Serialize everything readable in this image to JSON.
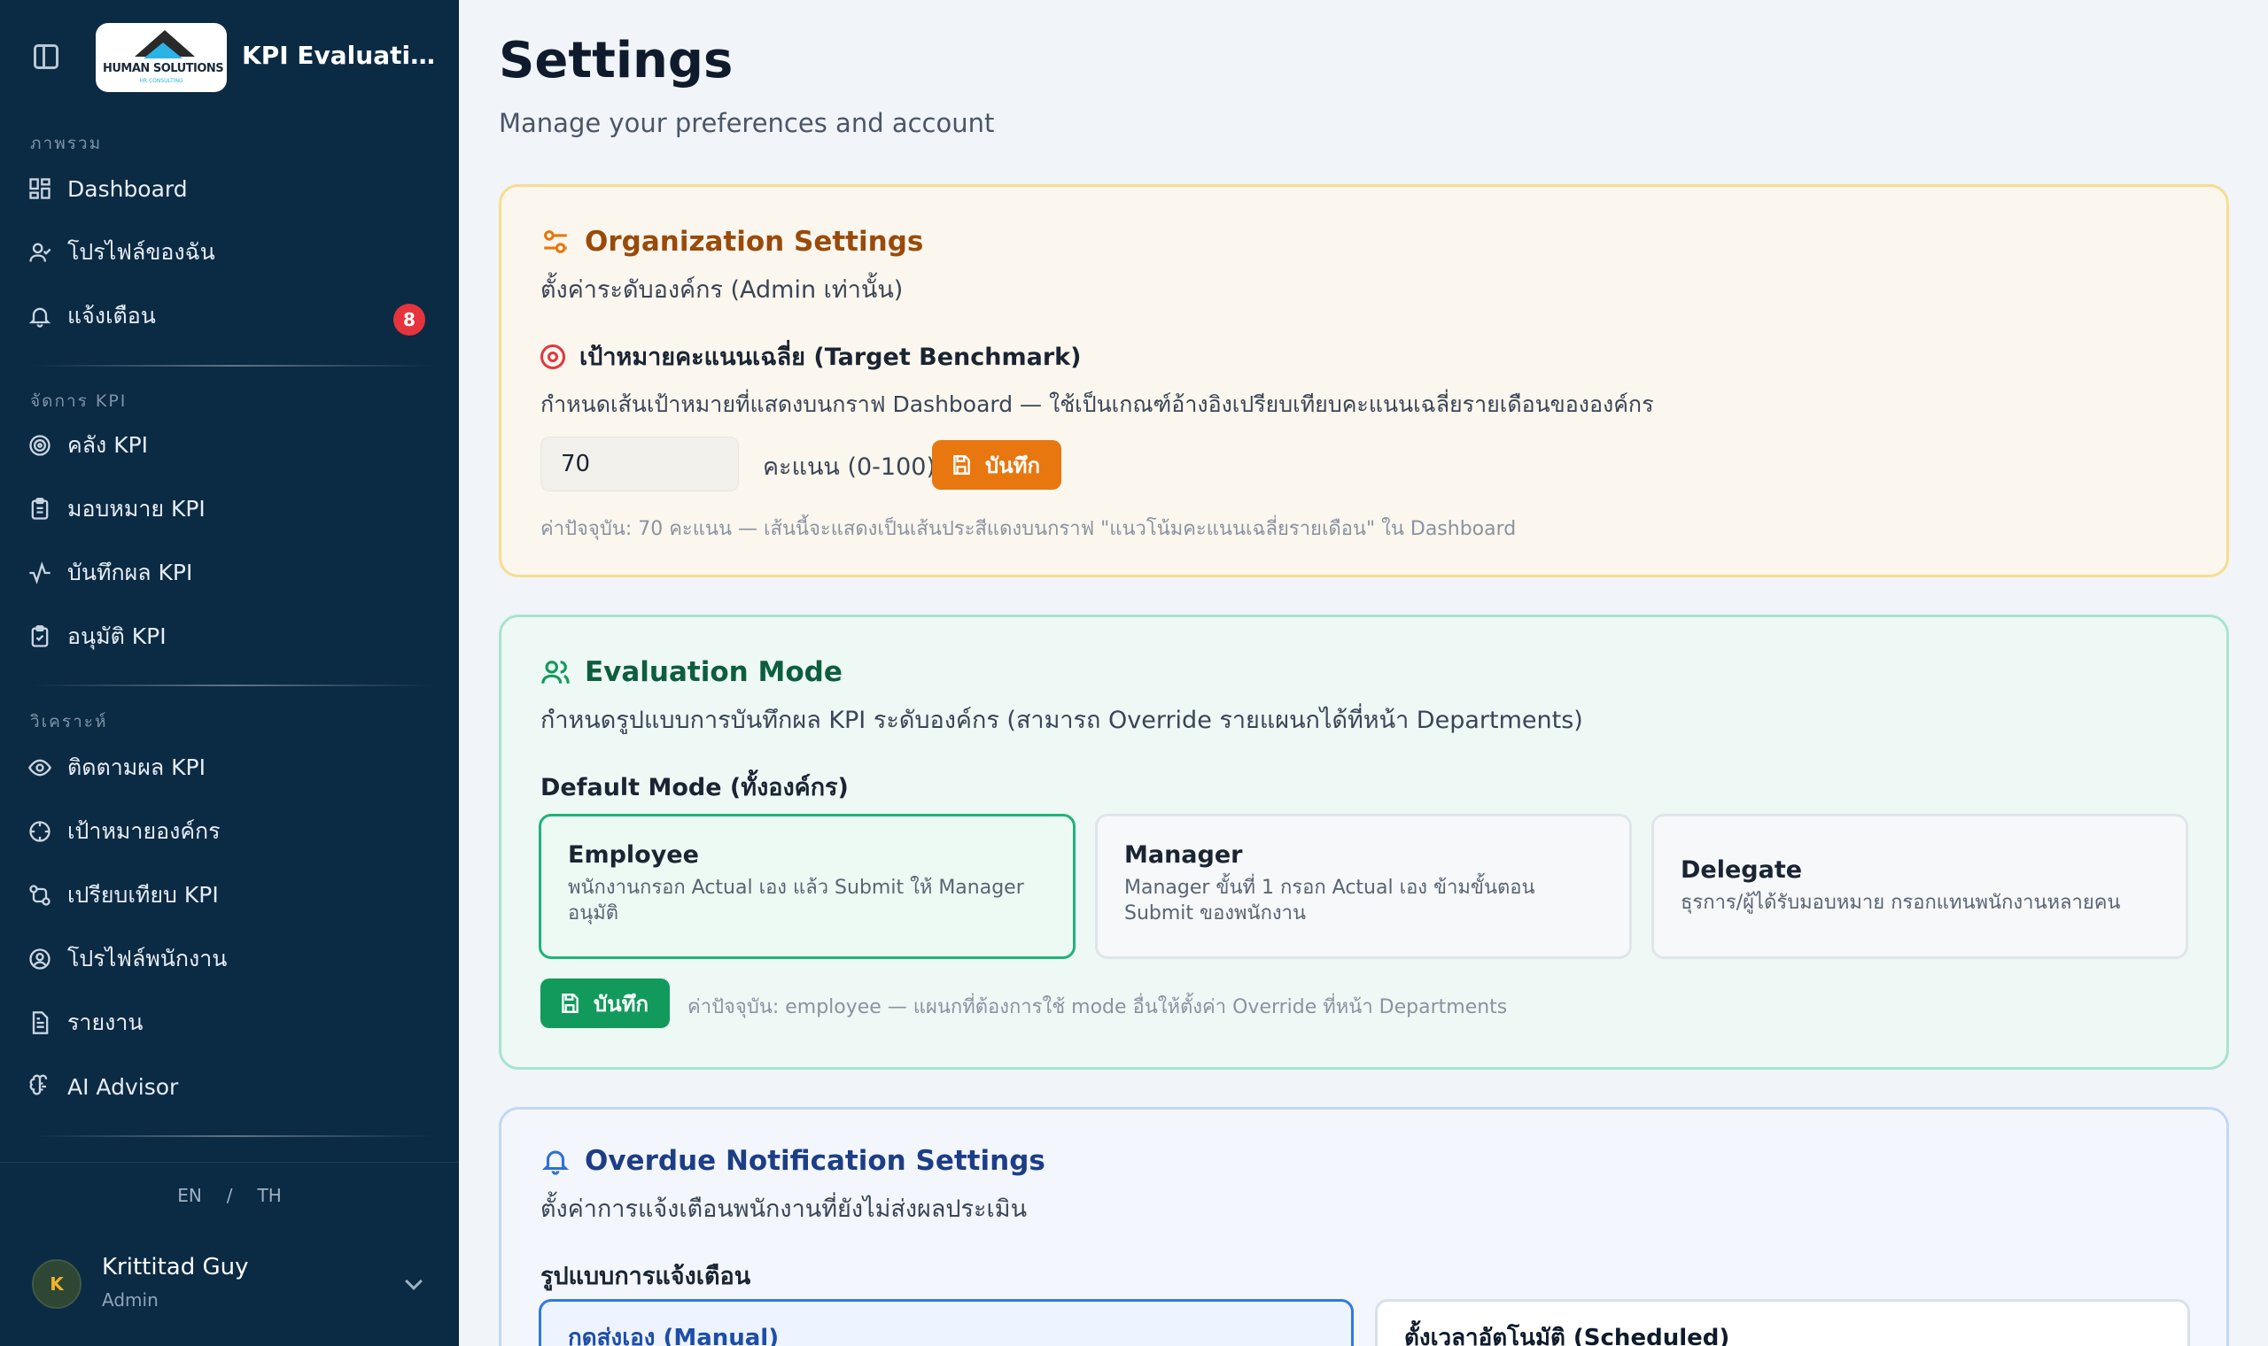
{
  "app": {
    "title": "KPI Evaluation ...",
    "logo_text": "HUMAN SOLUTIONS",
    "logo_sub": "HR CONSULTING"
  },
  "sidebar": {
    "sections": [
      {
        "label": "ภาพรวม"
      },
      {
        "label": "จัดการ KPI"
      },
      {
        "label": "วิเคราะห์"
      }
    ],
    "items": [
      {
        "label": "Dashboard",
        "icon": "dashboard-icon"
      },
      {
        "label": "โปรไฟล์ของฉัน",
        "icon": "user-icon"
      },
      {
        "label": "แจ้งเตือน",
        "icon": "bell-icon",
        "badge": "8"
      },
      {
        "label": "คลัง KPI",
        "icon": "target-icon"
      },
      {
        "label": "มอบหมาย KPI",
        "icon": "clipboard-list-icon"
      },
      {
        "label": "บันทึกผล KPI",
        "icon": "activity-icon"
      },
      {
        "label": "อนุมัติ KPI",
        "icon": "clipboard-check-icon"
      },
      {
        "label": "ติดตามผล KPI",
        "icon": "eye-icon"
      },
      {
        "label": "เป้าหมายองค์กร",
        "icon": "crosshair-icon"
      },
      {
        "label": "เปรียบเทียบ KPI",
        "icon": "compare-icon"
      },
      {
        "label": "โปรไฟล์พนักงาน",
        "icon": "user-circle-icon"
      },
      {
        "label": "รายงาน",
        "icon": "file-text-icon"
      },
      {
        "label": "AI Advisor",
        "icon": "brain-icon"
      }
    ],
    "lang": {
      "en": "EN",
      "sep": "/",
      "th": "TH"
    },
    "user": {
      "initial": "K",
      "name": "Krittitad Guy",
      "role": "Admin"
    }
  },
  "page": {
    "title": "Settings",
    "subtitle": "Manage your preferences and account"
  },
  "org_settings": {
    "title": "Organization Settings",
    "desc": "ตั้งค่าระดับองค์กร (Admin เท่านั้น)",
    "benchmark_title": "เป้าหมายคะแนนเฉลี่ย (Target Benchmark)",
    "benchmark_desc": "กำหนดเส้นเป้าหมายที่แสดงบนกราฟ Dashboard — ใช้เป็นเกณฑ์อ้างอิงเปรียบเทียบคะแนนเฉลี่ยรายเดือนขององค์กร",
    "value": "70",
    "unit": "คะแนน (0-100)",
    "save_label": "บันทึก",
    "hint": "ค่าปัจจุบัน: 70 คะแนน — เส้นนี้จะแสดงเป็นเส้นประสีแดงบนกราฟ \"แนวโน้มคะแนนเฉลี่ยรายเดือน\" ใน Dashboard"
  },
  "eval_mode": {
    "title": "Evaluation Mode",
    "desc": "กำหนดรูปแบบการบันทึกผล KPI ระดับองค์กร (สามารถ Override รายแผนกได้ที่หน้า Departments)",
    "default_label": "Default Mode (ทั้งองค์กร)",
    "modes": [
      {
        "title": "Employee",
        "desc": "พนักงานกรอก Actual เอง แล้ว Submit ให้ Manager อนุมัติ"
      },
      {
        "title": "Manager",
        "desc": "Manager ขั้นที่ 1 กรอก Actual เอง ข้ามขั้นตอน Submit ของพนักงาน"
      },
      {
        "title": "Delegate",
        "desc": "ธุรการ/ผู้ได้รับมอบหมาย กรอกแทนพนักงานหลายคน"
      }
    ],
    "save_label": "บันทึก",
    "hint": "ค่าปัจจุบัน: employee — แผนกที่ต้องการใช้ mode อื่นให้ตั้งค่า Override ที่หน้า Departments"
  },
  "notif": {
    "title": "Overdue Notification Settings",
    "desc": "ตั้งค่าการแจ้งเตือนพนักงานที่ยังไม่ส่งผลประเมิน",
    "format_label": "รูปแบบการแจ้งเตือน",
    "options": [
      {
        "label": "กดส่งเอง (Manual)"
      },
      {
        "label": "ตั้งเวลาอัตโนมัติ (Scheduled)"
      }
    ]
  },
  "colors": {
    "sidebar_bg": "#0b2a44",
    "org_accent": "#9a4a0a",
    "eval_accent": "#0d5e3e",
    "notif_accent": "#1d3e86",
    "save_orange": "#e8770f",
    "save_green": "#119a5c",
    "badge_red": "#e5343d"
  }
}
